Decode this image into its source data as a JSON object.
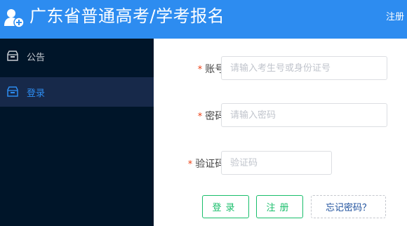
{
  "header": {
    "title": "广东省普通高考/学考报名",
    "register_link": "注册",
    "logo_icon": "user-add-icon",
    "background": "#2d8cf0"
  },
  "sidebar": {
    "items": [
      {
        "label": "公告",
        "icon": "notice-box-icon",
        "active": false
      },
      {
        "label": "登录",
        "icon": "login-box-icon",
        "active": true
      }
    ]
  },
  "form": {
    "account": {
      "label": "账号:",
      "placeholder": "请输入考生号或身份证号",
      "required": true
    },
    "password": {
      "label": "密码:",
      "placeholder": "请输入密码",
      "required": true
    },
    "captcha": {
      "label": "验证码:",
      "placeholder": "验证码",
      "required": true
    },
    "required_mark": "*"
  },
  "buttons": {
    "login": "登录",
    "register": "注册",
    "forgot": "忘记密码？"
  },
  "colors": {
    "accent": "#2d8cf0",
    "sidebar_bg": "#001529",
    "active_bg": "#17294a",
    "success": "#19be6b",
    "required": "#ed4014"
  }
}
